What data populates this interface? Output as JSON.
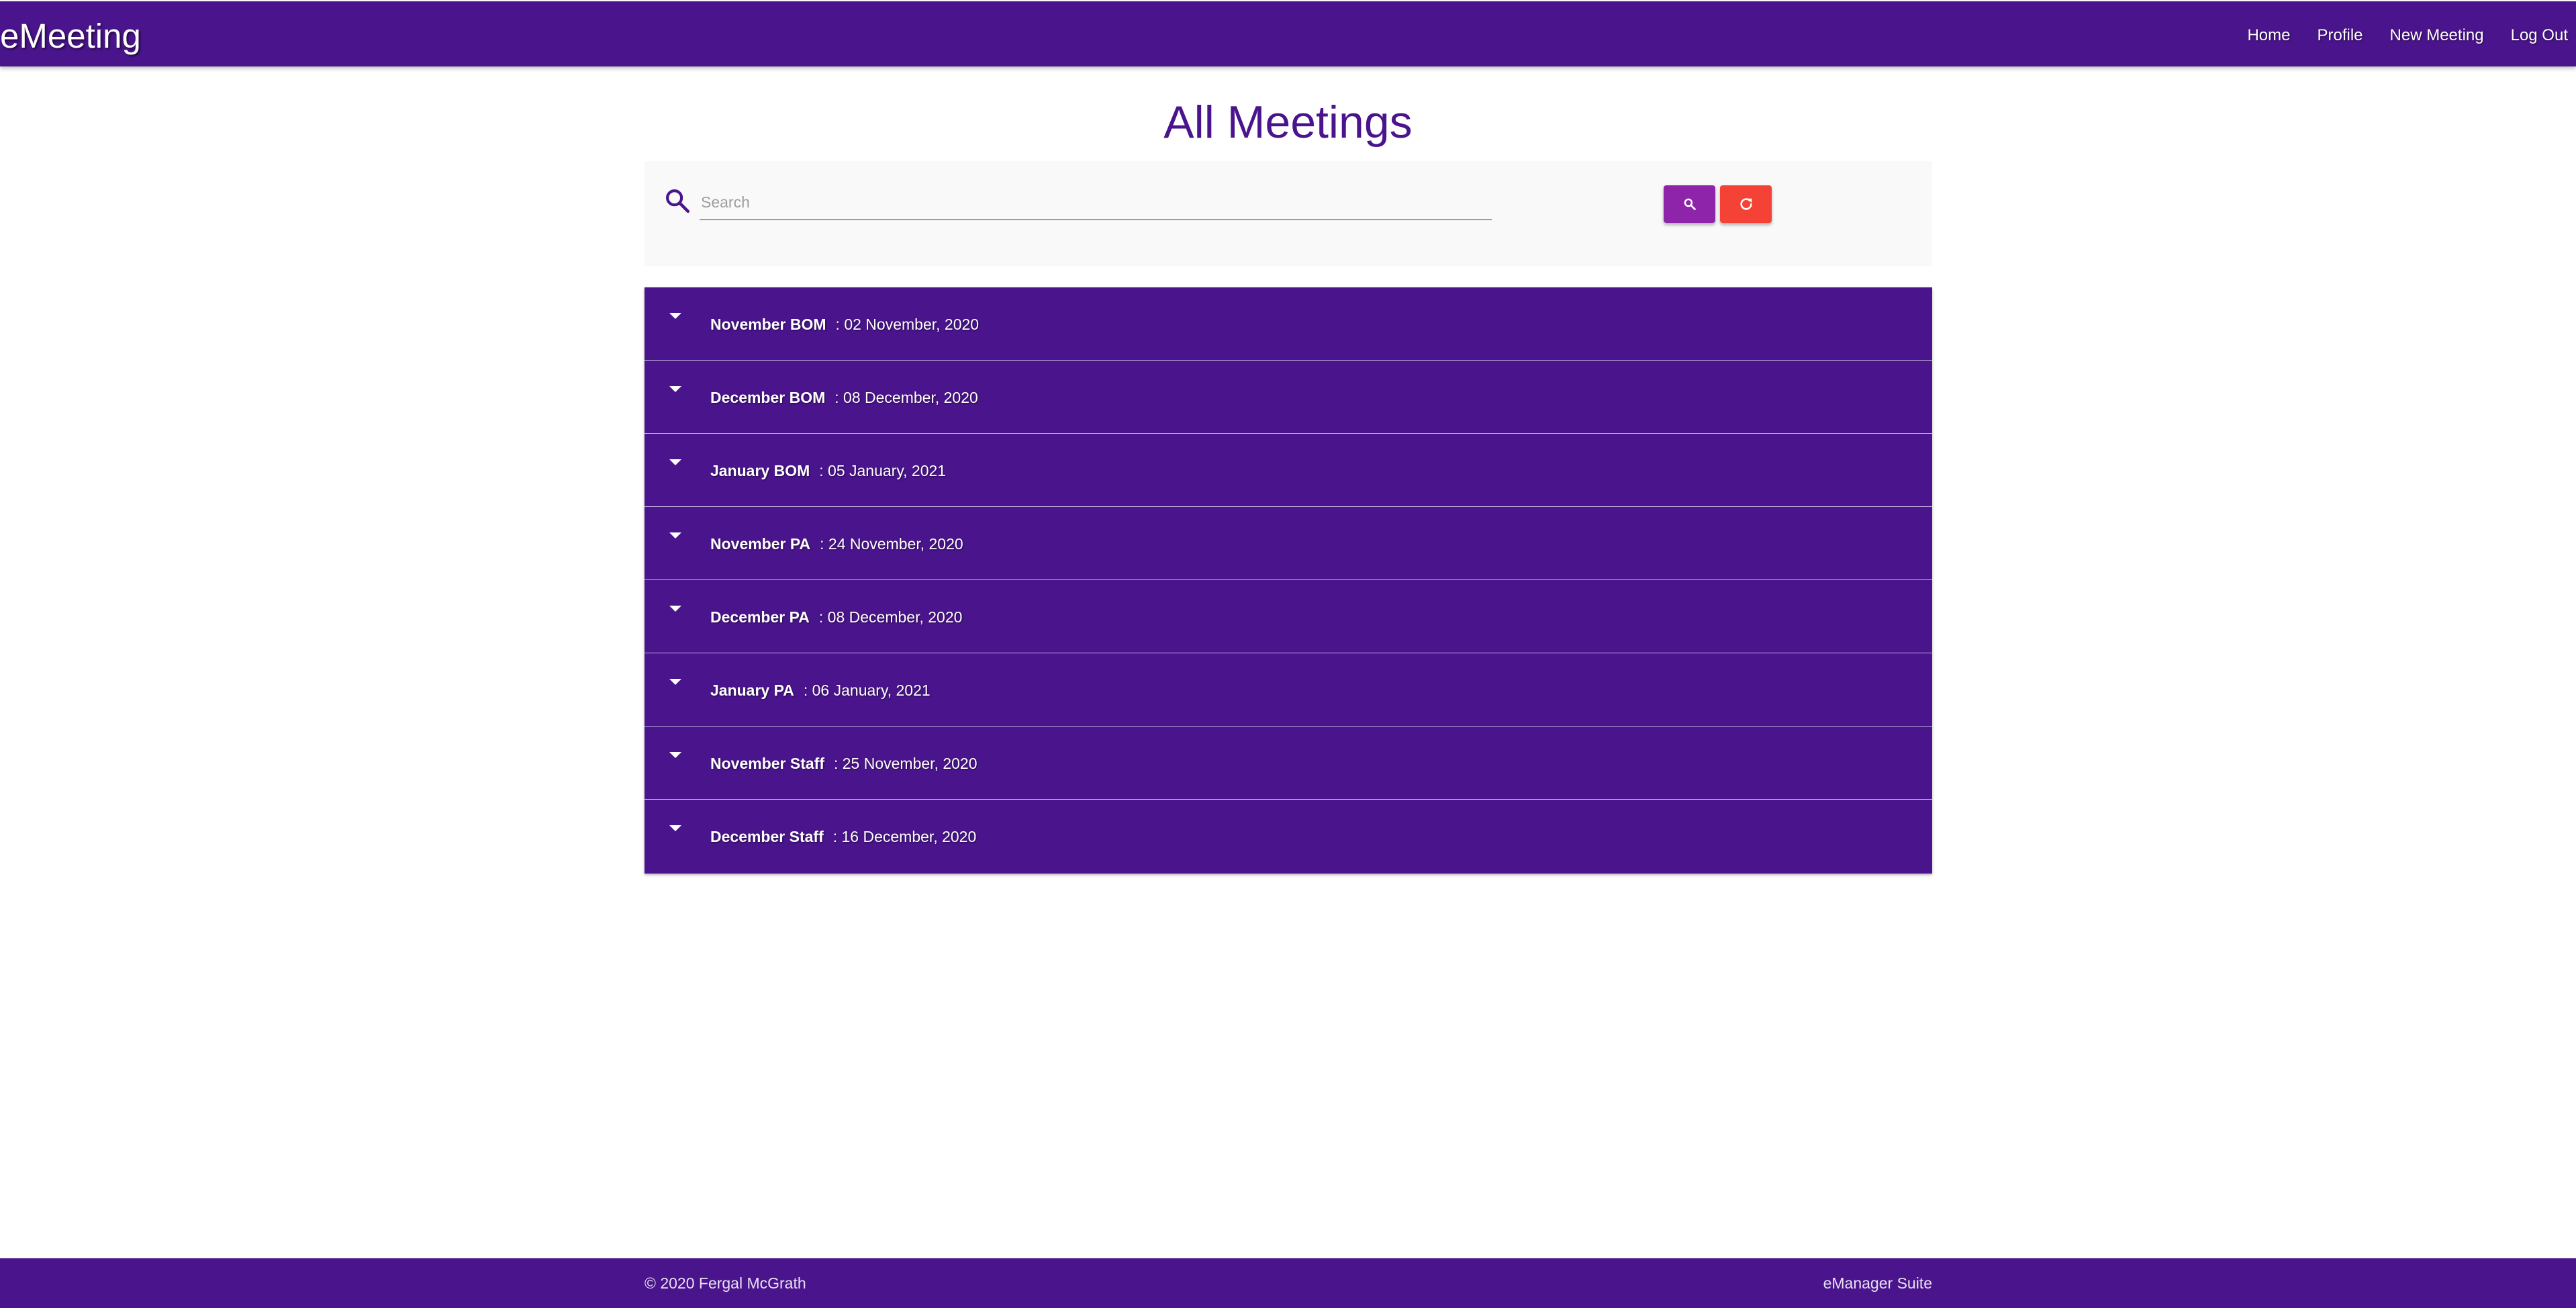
{
  "app": {
    "brand": "eMeeting"
  },
  "nav": {
    "items": [
      {
        "label": "Home"
      },
      {
        "label": "Profile"
      },
      {
        "label": "New Meeting"
      },
      {
        "label": "Log Out"
      }
    ]
  },
  "page": {
    "title": "All Meetings"
  },
  "search": {
    "placeholder": "Search",
    "value": "",
    "icon": "search-icon",
    "search_button_icon": "magnifier-icon",
    "reset_button_icon": "refresh-icon"
  },
  "meetings": [
    {
      "name": "November BOM",
      "date": ": 02 November, 2020"
    },
    {
      "name": "December BOM",
      "date": ": 08 December, 2020"
    },
    {
      "name": "January BOM",
      "date": ": 05 January, 2021"
    },
    {
      "name": "November PA",
      "date": ": 24 November, 2020"
    },
    {
      "name": "December PA",
      "date": ": 08 December, 2020"
    },
    {
      "name": "January PA",
      "date": ": 06 January, 2021"
    },
    {
      "name": "November Staff",
      "date": ": 25 November, 2020"
    },
    {
      "name": "December Staff",
      "date": ": 16 December, 2020"
    }
  ],
  "footer": {
    "copyright": "© 2020 Fergal McGrath",
    "suite": "eManager Suite"
  },
  "colors": {
    "primary": "#4a148c",
    "search_button": "#8e24aa",
    "reset_button": "#f44336"
  }
}
